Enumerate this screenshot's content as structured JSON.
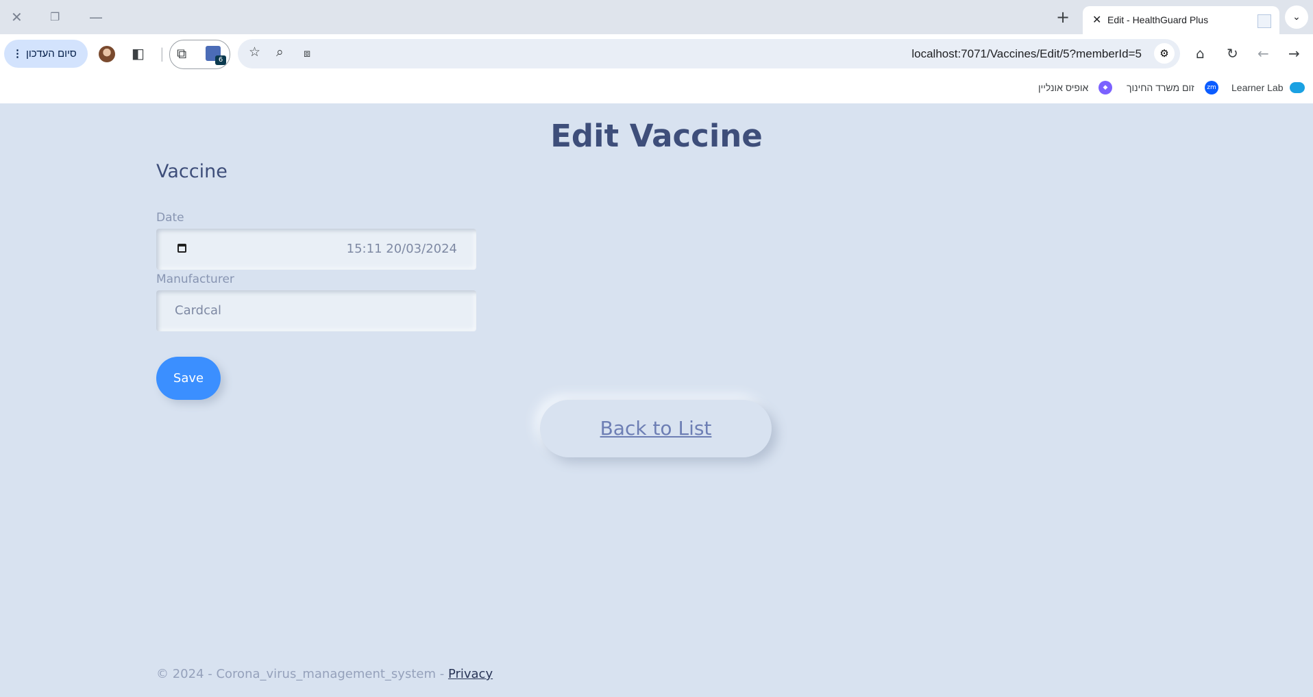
{
  "browser": {
    "tab_title": "Edit - HealthGuard Plus",
    "url": "localhost:7071/Vaccines/Edit/5?memberId=5",
    "update_button_label": "סיום העדכון",
    "extension_badge_count": "6",
    "bookmarks": [
      {
        "label": "Learner Lab",
        "icon": "cloud-icon",
        "color": "#1ba1e2"
      },
      {
        "label": "זום משרד החינוך",
        "icon": "zoom-icon",
        "color": "#0b5cff"
      },
      {
        "label": "אופיס אונליין",
        "icon": "office-icon",
        "color": "#7b61ff"
      }
    ]
  },
  "page": {
    "title": "Edit Vaccine",
    "section_heading": "Vaccine",
    "fields": {
      "date": {
        "label": "Date",
        "value": "15:11 20/03/2024"
      },
      "manufacturer": {
        "label": "Manufacturer",
        "value": "Cardcal"
      }
    },
    "save_label": "Save",
    "back_label": "Back to List",
    "footer_text": "© 2024 - Corona_virus_management_system - ",
    "footer_link": "Privacy"
  },
  "colors": {
    "page_background": "#d8e2f0",
    "heading": "#3e4e7a",
    "primary_button": "#3b8fff"
  }
}
